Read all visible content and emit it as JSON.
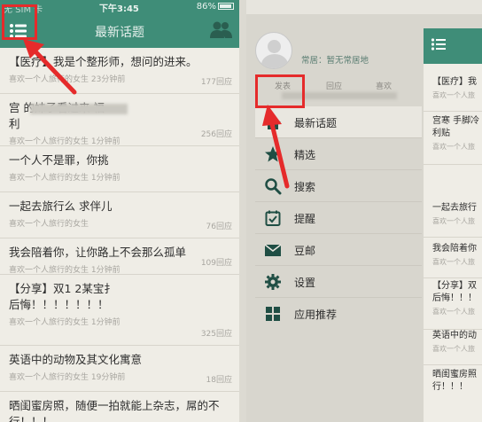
{
  "left": {
    "status": {
      "carrier": "无 SIM 卡",
      "time": "下午3:45",
      "battery": "86%"
    },
    "title": "最新话题",
    "items": [
      {
        "title": "【医疗】我是个整形师，想问的进来。",
        "meta": "喜欢一个人旅行的女生 23分钟前",
        "count": "177回应"
      },
      {
        "title": "宫 的妹子看过来 福\n利",
        "meta": "喜欢一个人旅行的女生 1分钟前",
        "count": "256回应"
      },
      {
        "title": "一个人不是罪，你挑",
        "meta": "喜欢一个人旅行的女生 1分钟前",
        "count": ""
      },
      {
        "title": "一起去旅行么 求伴儿",
        "meta": "喜欢一个人旅行的女生",
        "count": "76回应"
      },
      {
        "title": "我会陪着你，让你路上不会那么孤单",
        "meta": "喜欢一个人旅行的女生 1分钟前",
        "count": "109回应"
      },
      {
        "title": "【分享】双1 2某宝扌\n后悔！！！！！！！",
        "meta": "喜欢一个人旅行的女生 1分钟前",
        "count": "325回应"
      },
      {
        "title": "英语中的动物及其文化寓意",
        "meta": "喜欢一个人旅行的女生 19分钟前",
        "count": "18回应"
      },
      {
        "title": "晒闺蜜房照，随便一拍就能上杂志，屌的不\n行！！！",
        "meta": "",
        "count": ""
      }
    ]
  },
  "right": {
    "resident": "常居：暂无常居地",
    "stats": [
      "发表",
      "回应",
      "喜欢"
    ],
    "menu": [
      {
        "label": "最新话题",
        "icon": "home-icon"
      },
      {
        "label": "精选",
        "icon": "star-icon"
      },
      {
        "label": "搜索",
        "icon": "search-icon"
      },
      {
        "label": "提醒",
        "icon": "reminder-icon"
      },
      {
        "label": "豆邮",
        "icon": "mail-icon"
      },
      {
        "label": "设置",
        "icon": "gear-icon"
      },
      {
        "label": "应用推荐",
        "icon": "apps-icon"
      }
    ],
    "peek": [
      {
        "title": "【医疗】我",
        "meta": "喜欢一个人旅"
      },
      {
        "title": "宫寒 手脚冷\n利贴",
        "meta": "喜欢一个人旅"
      },
      {
        "title": "一起去旅行",
        "meta": "喜欢一个人旅"
      },
      {
        "title": "我会陪着你",
        "meta": "喜欢一个人旅"
      },
      {
        "title": "【分享】双\n后悔！！！",
        "meta": "喜欢一个人旅"
      },
      {
        "title": "英语中的动",
        "meta": "喜欢一个人旅"
      },
      {
        "title": "晒闺蜜房照\n行！！！",
        "meta": ""
      }
    ]
  },
  "colors": {
    "theme": "#3f8d78",
    "annotation": "#e52b2b"
  }
}
